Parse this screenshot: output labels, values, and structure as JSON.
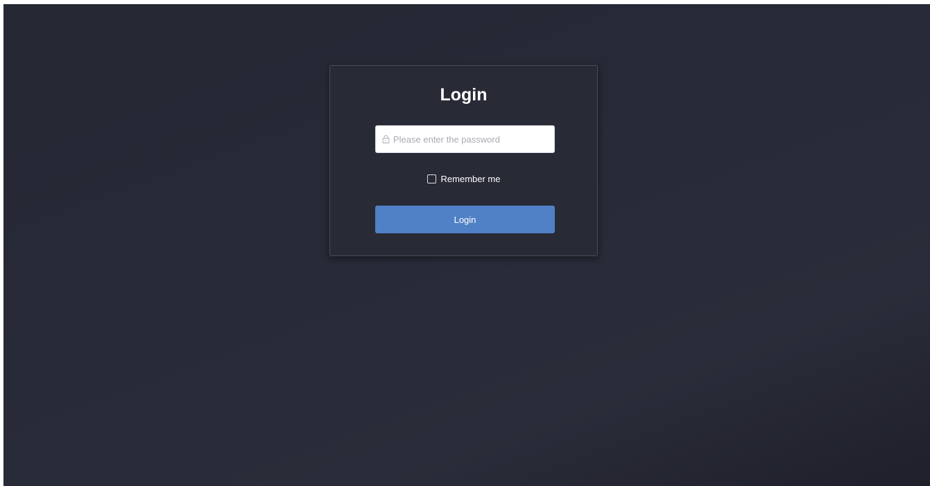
{
  "login_card": {
    "title": "Login",
    "password_field": {
      "icon": "lock-icon",
      "value": "",
      "placeholder": "Please enter the password"
    },
    "remember_me": {
      "label": "Remember me",
      "checked": false
    },
    "submit_label": "Login"
  },
  "colors": {
    "background": "#272a37",
    "card": "#282a36",
    "accent": "#5081c6",
    "text": "#ffffff",
    "placeholder": "#a8abb2"
  }
}
